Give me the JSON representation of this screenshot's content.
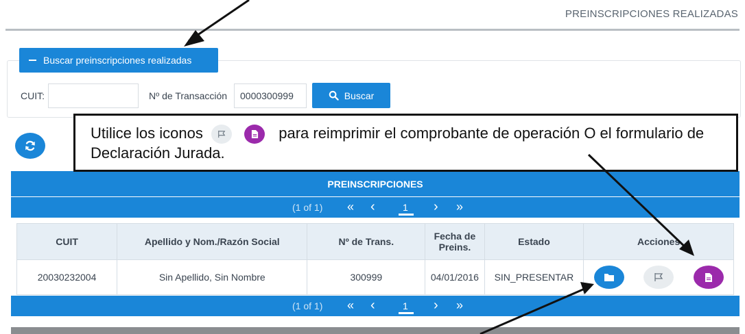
{
  "header": {
    "title": "PREINSCRIPCIONES REALIZADAS"
  },
  "search": {
    "toggle_label": "Buscar preinscripciones realizadas",
    "cuit_label": "CUIT:",
    "cuit_value": "",
    "trans_label": "Nº de Transacción",
    "trans_value": "0000300999",
    "button_label": "Buscar"
  },
  "callout": {
    "line_part1": "Utilice los iconos",
    "line_part2": "para reimprimir el comprobante de operación O el formulario de Declaración Jurada."
  },
  "table": {
    "title": "PREINSCRIPCIONES",
    "pager": {
      "info": "(1 of 1)",
      "first": "«",
      "prev": "‹",
      "page": "1",
      "next": "›",
      "last": "»"
    },
    "columns": [
      "CUIT",
      "Apellido y Nom./Razón Social",
      "Nº de Trans.",
      "Fecha de Preins.",
      "Estado",
      "Acciones"
    ],
    "rows": [
      {
        "cuit": "20030232004",
        "name": "Sin Apellido, Sin Nombre",
        "trans": "300999",
        "fecha": "04/01/2016",
        "estado": "SIN_PRESENTAR"
      }
    ]
  },
  "colors": {
    "primary": "#1a86d8",
    "purple": "#9b2aab",
    "flag_bg": "#e8ecef"
  },
  "icons": [
    "minus-icon",
    "search-icon",
    "refresh-icon",
    "folder-icon",
    "flag-icon",
    "document-icon"
  ]
}
